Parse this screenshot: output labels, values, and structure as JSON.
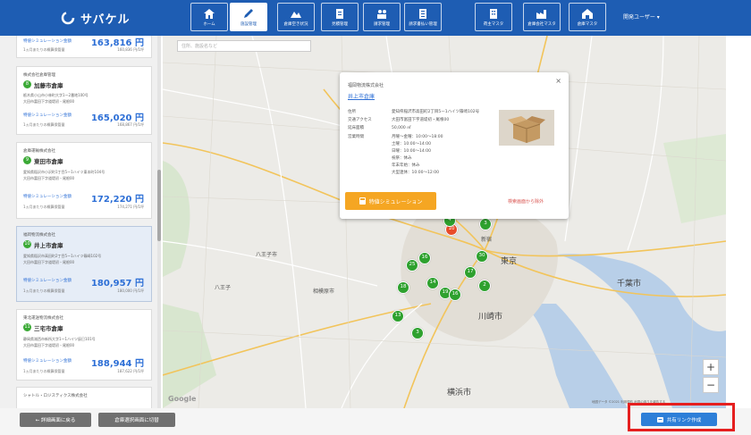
{
  "header": {
    "app_name": "サバケル",
    "nav": [
      {
        "label": "ホーム",
        "icon": "home-icon"
      },
      {
        "label": "施設管理",
        "icon": "pen-icon"
      },
      {
        "label": "倉庫空き状況",
        "icon": "map-icon"
      },
      {
        "label": "見積管理",
        "icon": "document-icon"
      },
      {
        "label": "請求管理",
        "icon": "people-icon"
      },
      {
        "label": "請求書払い管理",
        "icon": "invoice-icon"
      },
      {
        "label": "荷主マスタ",
        "icon": "building-icon"
      },
      {
        "label": "倉庫会社マスタ",
        "icon": "factory-icon"
      },
      {
        "label": "倉庫マスタ",
        "icon": "warehouse-icon"
      }
    ],
    "user_label": "開発ユーザー ▾"
  },
  "sidebar": {
    "cards": [
      {
        "company": "",
        "badge": "",
        "name": "",
        "address": "",
        "sim_label": "特値シミュレーション金額",
        "price": "163,816 円",
        "month_label": "1ヵ月あたりの概算保管量",
        "per": "160,836 円/1坪"
      },
      {
        "company": "株式会社倉庫管理",
        "badge": "8",
        "name": "加藤市倉庫",
        "address": "栃木県小山市小林町大字1ー2番地100号",
        "address2": "大田市富田下字道堤初・尾根00",
        "sim_label": "特値シミュレーション金額",
        "price": "165,020 円",
        "month_label": "1ヵ月あたりの概算保管量",
        "per": "168,867 円/1坪"
      },
      {
        "company": "倉庫運輸株式会社",
        "badge": "9",
        "name": "東田市倉庫",
        "address": "愛知県稲沢市小沢町1丁目5ー1ハイツ東本町104号",
        "address2": "大田市富田下字道堤初・尾根00",
        "sim_label": "特値シミュレーション金額",
        "price": "172,220 円",
        "month_label": "1ヵ月あたりの概算保管量",
        "per": "174,271 円/1坪"
      },
      {
        "company": "福岡物流株式会社",
        "badge": "10",
        "name": "井上市倉庫",
        "address": "愛知県稲沢市高田町2丁目5ー1ハイツ篠崎102号",
        "address2": "大田市富田下字道堤初・尾根00",
        "sim_label": "特値シミュレーション金額",
        "price": "180,957 円",
        "month_label": "1ヵ月あたりの概算保管量",
        "per": "180,000 円/1坪"
      },
      {
        "company": "東北運送物流株式会社",
        "badge": "11",
        "name": "三宅市倉庫",
        "address": "静岡県湖西市新所大字1ー1ハイツ辰巳101号",
        "address2": "大田市富田下字道堤初・尾根00",
        "sim_label": "特値シミュレーション金額",
        "price": "188,944 円",
        "month_label": "1ヵ月あたりの概算保管量",
        "per": "187,622 円/1坪"
      },
      {
        "company": "シャトル・ロジスティクス株式会社",
        "badge": "",
        "name": "",
        "address": ""
      }
    ]
  },
  "map": {
    "search_placeholder": "住所、施設名など",
    "places": [
      "新宿",
      "東京",
      "八王子市",
      "相模原市",
      "川崎市",
      "横浜市",
      "千葉市",
      "八王子"
    ],
    "clusters": [
      "3",
      "10",
      "4",
      "25",
      "16",
      "30",
      "17",
      "14",
      "19",
      "16",
      "2",
      "18",
      "13",
      "3"
    ],
    "zoom_in": "+",
    "zoom_out": "−",
    "google": "Google",
    "footer": "地図データ ©2021  利用規約  地図の誤りを報告する"
  },
  "popup": {
    "company": "福岡物流株式会社",
    "name": "井上市倉庫",
    "rows": [
      {
        "k": "住所",
        "v": "愛知県稲沢市高田町2丁目5ー1ハイツ篠崎102号"
      },
      {
        "k": "交通アクセス",
        "v": "大田市富田下字道堤初・尾根00"
      },
      {
        "k": "延床面積",
        "v": "50,000 ㎡"
      },
      {
        "k": "営業時間",
        "v": "月曜〜金曜：10:00〜18:00"
      },
      {
        "k": "",
        "v": "土曜：10:00〜14:00"
      },
      {
        "k": "",
        "v": "日曜：10:00〜14:00"
      },
      {
        "k": "",
        "v": "祝祭：休み"
      },
      {
        "k": "",
        "v": "年末年始：休み"
      },
      {
        "k": "",
        "v": "大型連休：10:00〜12:00"
      }
    ],
    "sim_button": "特値シミュレーション",
    "remove_link": "検索画面から除外",
    "close": "×"
  },
  "footer": {
    "back_button": "← 詳細画面に戻る",
    "switch_button": "倉庫選択画面に切替",
    "share_button": "共有リンク作成"
  },
  "colors": {
    "header": "#1e5db3",
    "accent": "#2d7fd8",
    "pin_green": "#2ea12e",
    "pin_red": "#e84c2a",
    "sim_orange": "#f5a623",
    "highlight": "#e51f1f"
  }
}
